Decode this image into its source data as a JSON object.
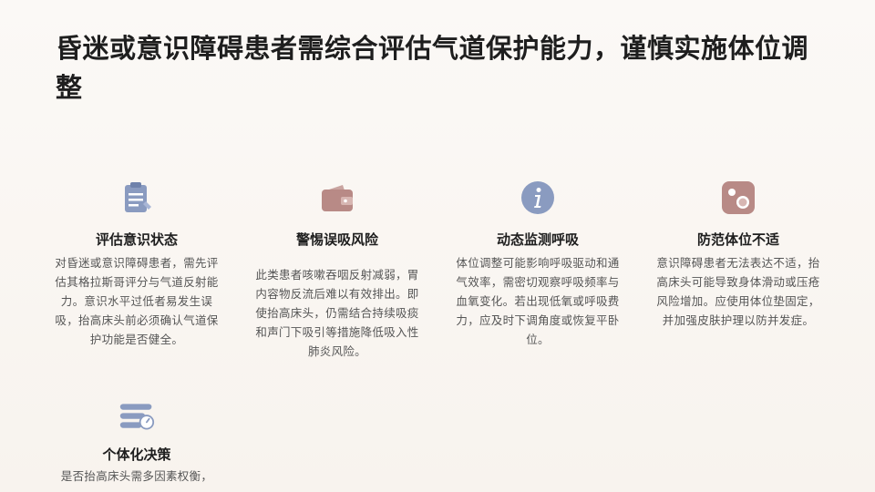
{
  "page": {
    "title": "昏迷或意识障碍患者需综合评估气道保护能力，谨慎实施体位调整"
  },
  "cards": [
    {
      "icon": "clipboard-icon",
      "title": "评估意识状态",
      "body": "对昏迷或意识障碍患者，需先评估其格拉斯哥评分与气道反射能力。意识水平过低者易发生误吸，抬高床头前必须确认气道保护功能是否健全。"
    },
    {
      "icon": "wallet-icon",
      "title": "警惕误吸风险",
      "body": "此类患者咳嗽吞咽反射减弱，胃内容物反流后难以有效排出。即使抬高床头，仍需结合持续吸痰和声门下吸引等措施降低吸入性肺炎风险。"
    },
    {
      "icon": "info-icon",
      "title": "动态监测呼吸",
      "body": "体位调整可能影响呼吸驱动和通气效率，需密切观察呼吸频率与血氧变化。若出现低氧或呼吸费力，应及时下调角度或恢复平卧位。"
    },
    {
      "icon": "circles-icon",
      "title": "防范体位不适",
      "body": "意识障碍患者无法表达不适，抬高床头可能导致身体滑动或压疮风险增加。应使用体位垫固定，并加强皮肤护理以防并发症。"
    },
    {
      "icon": "server-gauge-icon",
      "title": "个体化决策",
      "body": "是否抬高床头需多因素权衡，"
    }
  ]
}
